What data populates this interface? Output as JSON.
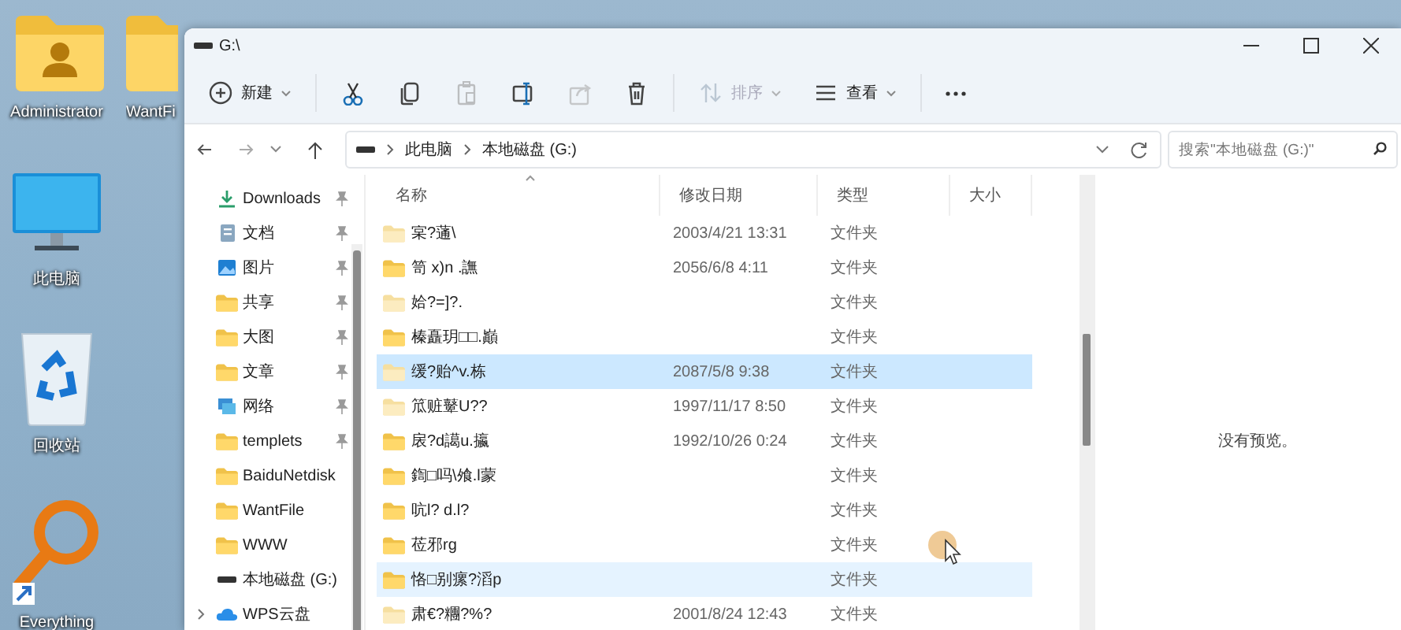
{
  "desktop_icons": [
    {
      "label": "Administrator",
      "kind": "user-folder"
    },
    {
      "label": "WantFi",
      "kind": "folder"
    },
    {
      "label": "此电脑",
      "kind": "computer"
    },
    {
      "label": "回收站",
      "kind": "recycle-bin"
    },
    {
      "label": "Everything",
      "kind": "search-app"
    }
  ],
  "window": {
    "title": "G:\\"
  },
  "toolbar": [
    {
      "kind": "new",
      "label": "新建",
      "disabled": false
    },
    {
      "kind": "cut",
      "disabled": false
    },
    {
      "kind": "copy",
      "disabled": false
    },
    {
      "kind": "paste",
      "disabled": true
    },
    {
      "kind": "rename",
      "disabled": false
    },
    {
      "kind": "share",
      "disabled": true
    },
    {
      "kind": "delete",
      "disabled": false
    },
    {
      "kind": "sort",
      "label": "排序",
      "disabled": true
    },
    {
      "kind": "view",
      "label": "查看",
      "disabled": false
    },
    {
      "kind": "more",
      "disabled": false
    }
  ],
  "address": {
    "path": [
      "此电脑",
      "本地磁盘 (G:)"
    ]
  },
  "search": {
    "placeholder": "搜索\"本地磁盘 (G:)\""
  },
  "nav": [
    {
      "label": "Downloads",
      "kind": "downloads",
      "pinned": true
    },
    {
      "label": "文档",
      "kind": "document",
      "pinned": true
    },
    {
      "label": "图片",
      "kind": "picture",
      "pinned": true
    },
    {
      "label": "共享",
      "kind": "folder",
      "pinned": true
    },
    {
      "label": "大图",
      "kind": "folder",
      "pinned": true
    },
    {
      "label": "文章",
      "kind": "folder",
      "pinned": true
    },
    {
      "label": "网络",
      "kind": "network",
      "pinned": true
    },
    {
      "label": "templets",
      "kind": "folder",
      "pinned": true
    },
    {
      "label": "BaiduNetdisk",
      "kind": "folder",
      "pinned": false
    },
    {
      "label": "WantFile",
      "kind": "folder",
      "pinned": false
    },
    {
      "label": "WWW",
      "kind": "folder",
      "pinned": false
    },
    {
      "label": "本地磁盘 (G:)",
      "kind": "drive",
      "pinned": false
    },
    {
      "label": "WPS云盘",
      "kind": "cloud",
      "pinned": false
    }
  ],
  "file_list": {
    "columns": [
      "名称",
      "修改日期",
      "类型",
      "大小"
    ],
    "rows": [
      {
        "name": "宲?蓪\\",
        "date": "2003/4/21 13:31",
        "type": "文件夹",
        "hidden": true,
        "selected": false,
        "hovered": false
      },
      {
        "name": "笥   x)n .譕",
        "date": "2056/6/8 4:11",
        "type": "文件夹",
        "hidden": false,
        "selected": false,
        "hovered": false
      },
      {
        "name": "姶?=]?.",
        "type": "文件夹",
        "hidden": true,
        "selected": false,
        "hovered": false
      },
      {
        "name": "榛矗玥□□.巓",
        "type": "文件夹",
        "hidden": false,
        "selected": false,
        "hovered": false
      },
      {
        "name": "缓?贻^v.栋",
        "date": "2087/5/8 9:38",
        "type": "文件夹",
        "hidden": true,
        "selected": true,
        "hovered": false
      },
      {
        "name": "笟赃鼙U??",
        "date": "1997/11/17 8:50",
        "type": "文件夹",
        "hidden": true,
        "selected": false,
        "hovered": false
      },
      {
        "name": "扆?d譪u.攍",
        "date": "1992/10/26 0:24",
        "type": "文件夹",
        "hidden": false,
        "selected": false,
        "hovered": false
      },
      {
        "name": "鍧□吗\\飧.l蒙",
        "type": "文件夹",
        "hidden": false,
        "selected": false,
        "hovered": false
      },
      {
        "name": "吭l?   d.l?",
        "type": "文件夹",
        "hidden": false,
        "selected": false,
        "hovered": false
      },
      {
        "name": "莅邪rg",
        "type": "文件夹",
        "hidden": false,
        "selected": false,
        "hovered": false
      },
      {
        "name": "恪□别瘰?滔p",
        "type": "文件夹",
        "hidden": false,
        "selected": false,
        "hovered": true
      },
      {
        "name": "肃€?糰?%?",
        "date": "2001/8/24 12:43",
        "type": "文件夹",
        "hidden": true,
        "selected": false,
        "hovered": false
      }
    ]
  },
  "preview": {
    "message": "没有预览。"
  }
}
